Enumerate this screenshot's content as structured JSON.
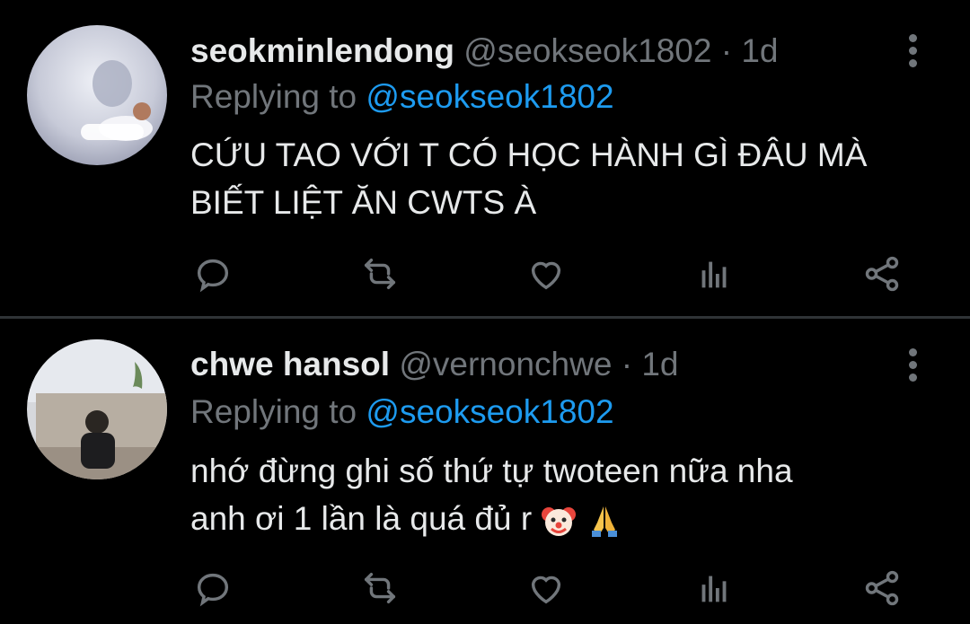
{
  "tweets": [
    {
      "name": "seokminlendong",
      "handle": "@seokseok1802",
      "separator": "·",
      "time": "1d",
      "replying_prefix": "Replying to",
      "replying_handle": "@seokseok1802",
      "text_line1": "CỨU TAO VỚI T CÓ HỌC HÀNH GÌ ĐÂU MÀ",
      "text_line2": "BIẾT LIỆT ĂN CWTS À"
    },
    {
      "name": "chwe hansol",
      "handle": "@vernonchwe",
      "separator": "·",
      "time": "1d",
      "replying_prefix": "Replying to",
      "replying_handle": "@seokseok1802",
      "text_line1": "nhớ đừng ghi số thứ tự twoteen nữa nha",
      "text_line2": "anh ơi 1 lần là quá đủ r",
      "emojis": [
        "clown-face",
        "folded-hands"
      ]
    }
  ],
  "action_icons": [
    "reply-icon",
    "retweet-icon",
    "like-icon",
    "analytics-icon",
    "share-icon"
  ],
  "colors": {
    "background": "#000000",
    "text": "#e7e9ea",
    "muted": "#71767b",
    "accent": "#1d9bf0",
    "divider": "#2f3336"
  }
}
